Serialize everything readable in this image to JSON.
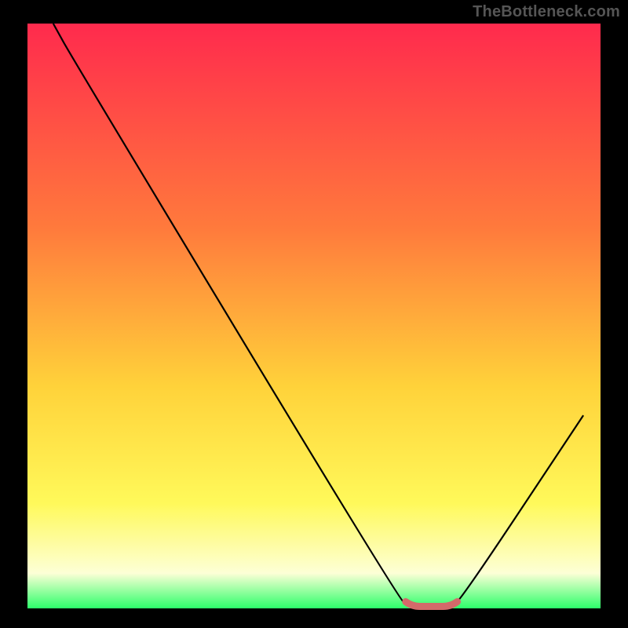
{
  "watermark": "TheBottleneck.com",
  "colors": {
    "bg_black": "#000000",
    "grad_top": "#ff2a4d",
    "grad_mid1": "#ff7a3c",
    "grad_mid2": "#ffd23a",
    "grad_low": "#fff95a",
    "grad_pale": "#fdffd6",
    "grad_green": "#2dff6a",
    "curve": "#000000",
    "marker": "#d46a6a"
  },
  "chart_data": {
    "type": "line",
    "title": "",
    "xlabel": "",
    "ylabel": "",
    "xlim": [
      0,
      100
    ],
    "ylim": [
      0,
      100
    ],
    "grid": false,
    "series": [
      {
        "name": "bottleneck-curve",
        "x": [
          4.5,
          8.0,
          65.0,
          66.5,
          74.0,
          75.5,
          97.0
        ],
        "values": [
          100.0,
          93.8,
          1.25,
          0.6,
          0.6,
          1.25,
          33.0
        ]
      }
    ],
    "markers": [
      {
        "name": "sweet-spot",
        "style": "rounded-band",
        "x_range": [
          66.0,
          75.0
        ],
        "y": 0.6
      }
    ],
    "annotations": []
  }
}
